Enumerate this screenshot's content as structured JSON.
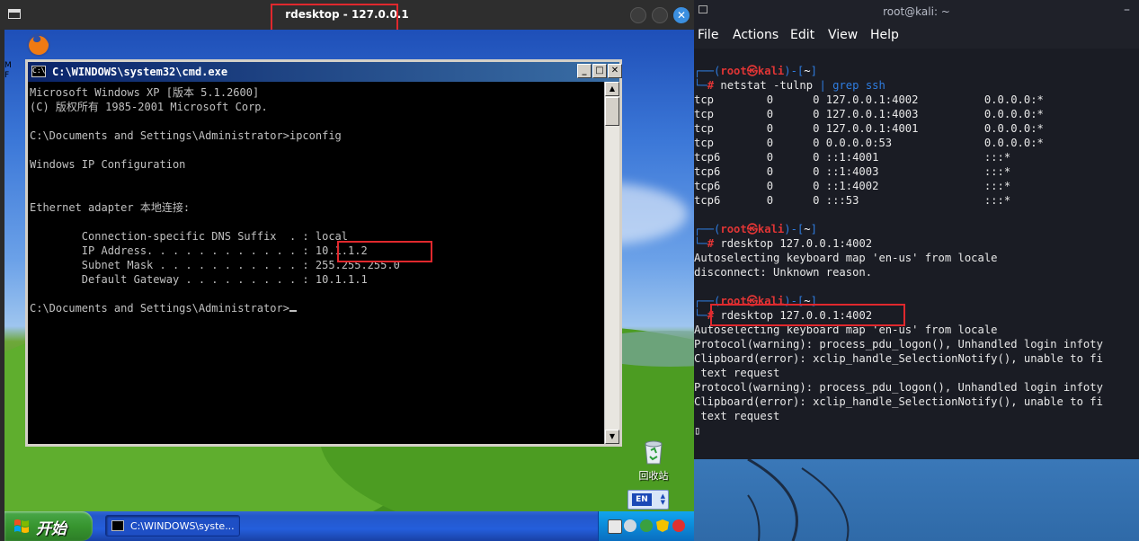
{
  "rdesktop": {
    "window_title": "rdesktop - 127.0.0.1",
    "close_glyph": "✕"
  },
  "xp": {
    "cmd": {
      "title": "C:\\WINDOWS\\system32\\cmd.exe",
      "icon_text": "C:\\",
      "lines": [
        "Microsoft Windows XP [版本 5.1.2600]",
        "(C) 版权所有 1985-2001 Microsoft Corp.",
        "",
        "C:\\Documents and Settings\\Administrator>ipconfig",
        "",
        "Windows IP Configuration",
        "",
        "",
        "Ethernet adapter 本地连接:",
        "",
        "        Connection-specific DNS Suffix  . : local",
        "        IP Address. . . . . . . . . . . . : 10.1.1.2",
        "        Subnet Mask . . . . . . . . . . . : 255.255.255.0",
        "        Default Gateway . . . . . . . . . : 10.1.1.1",
        "",
        "C:\\Documents and Settings\\Administrator>"
      ]
    },
    "desktop_icons": {
      "recycle_bin": "回收站",
      "left_edge_text": "M\nF"
    },
    "taskbar": {
      "start_label": "开始",
      "task_cmd_label": "C:\\WINDOWS\\syste...",
      "lang": "EN"
    }
  },
  "kali": {
    "window_title": "root@kali: ~",
    "min_glyph": "–",
    "menu": [
      "File",
      "Actions",
      "Edit",
      "View",
      "Help"
    ],
    "blocks": [
      {
        "prompt_user": "root㉿kali",
        "prompt_dir": "~",
        "command": "netstat -tulnp",
        "pipe": "| grep ssh",
        "output": [
          "tcp        0      0 127.0.0.1:4002          0.0.0.0:*",
          "tcp        0      0 127.0.0.1:4003          0.0.0.0:*",
          "tcp        0      0 127.0.0.1:4001          0.0.0.0:*",
          "tcp        0      0 0.0.0.0:53              0.0.0.0:*",
          "tcp6       0      0 ::1:4001                :::*",
          "tcp6       0      0 ::1:4003                :::*",
          "tcp6       0      0 ::1:4002                :::*",
          "tcp6       0      0 :::53                   :::*"
        ]
      },
      {
        "prompt_user": "root㉿kali",
        "prompt_dir": "~",
        "command": "rdesktop 127.0.0.1:4002",
        "pipe": "",
        "output": [
          "Autoselecting keyboard map 'en-us' from locale",
          "disconnect: Unknown reason."
        ]
      },
      {
        "prompt_user": "root㉿kali",
        "prompt_dir": "~",
        "command": "rdesktop 127.0.0.1:4002",
        "pipe": "",
        "output": [
          "Autoselecting keyboard map 'en-us' from locale",
          "Protocol(warning): process_pdu_logon(), Unhandled login infoty",
          "Clipboard(error): xclip_handle_SelectionNotify(), unable to fi",
          " text request",
          "Protocol(warning): process_pdu_logon(), Unhandled login infoty",
          "Clipboard(error): xclip_handle_SelectionNotify(), unable to fi",
          " text request"
        ]
      }
    ]
  },
  "colors": {
    "highlight_box": "#e0282d",
    "prompt_blue": "#2f7de1",
    "prompt_red": "#e03535"
  }
}
